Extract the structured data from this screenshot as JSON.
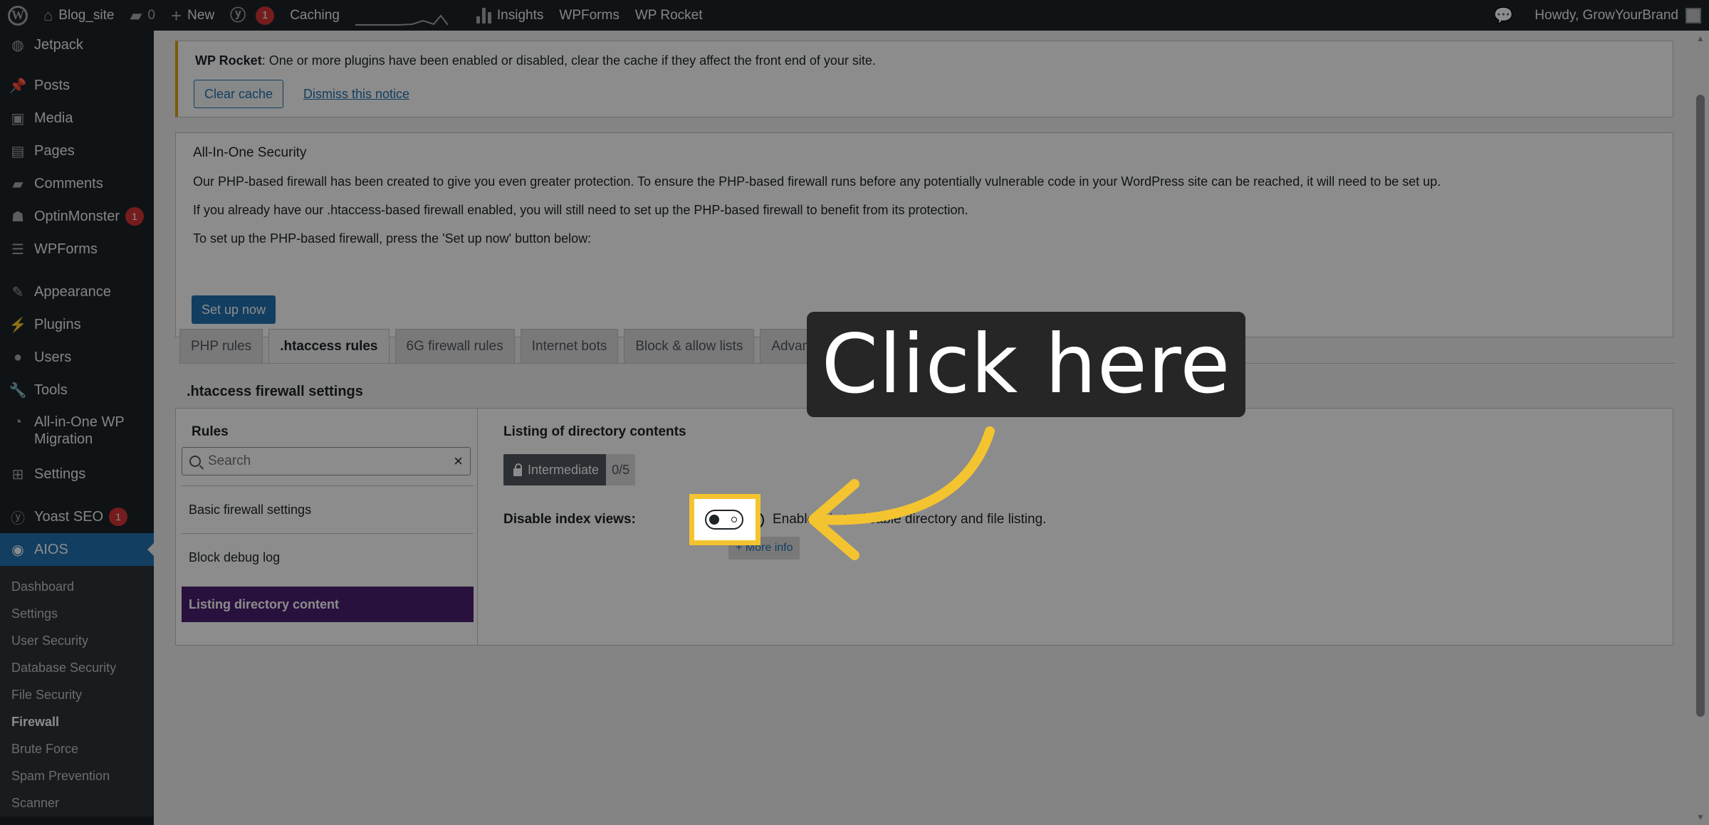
{
  "adminbar": {
    "site_name": "Blog_site",
    "comments_count": "0",
    "new_label": "New",
    "yoast_badge": "1",
    "caching_label": "Caching",
    "insights_label": "Insights",
    "wpforms_label": "WPForms",
    "wprocket_label": "WP Rocket",
    "howdy": "Howdy, GrowYourBrand"
  },
  "sidebar": {
    "items": [
      {
        "label": "Jetpack",
        "icon": "jetpack-icon"
      },
      {
        "label": "Posts",
        "icon": "pin-icon"
      },
      {
        "label": "Media",
        "icon": "media-icon"
      },
      {
        "label": "Pages",
        "icon": "pages-icon"
      },
      {
        "label": "Comments",
        "icon": "comment-icon"
      },
      {
        "label": "OptinMonster",
        "icon": "optinmonster-icon",
        "badge": "1"
      },
      {
        "label": "WPForms",
        "icon": "wpforms-icon"
      },
      {
        "label": "Appearance",
        "icon": "brush-icon"
      },
      {
        "label": "Plugins",
        "icon": "plugin-icon"
      },
      {
        "label": "Users",
        "icon": "user-icon"
      },
      {
        "label": "Tools",
        "icon": "wrench-icon"
      },
      {
        "label": "All-in-One WP Migration",
        "icon": "migration-icon"
      },
      {
        "label": "Settings",
        "icon": "settings-icon"
      },
      {
        "label": "Yoast SEO",
        "icon": "yoast-icon",
        "badge": "1"
      },
      {
        "label": "AIOS",
        "icon": "aios-icon"
      }
    ],
    "submenu": [
      "Dashboard",
      "Settings",
      "User Security",
      "Database Security",
      "File Security",
      "Firewall",
      "Brute Force",
      "Spam Prevention",
      "Scanner"
    ],
    "submenu_current": "Firewall"
  },
  "notice_rocket": {
    "brand": "WP Rocket",
    "text": ": One or more plugins have been enabled or disabled, clear the cache if they affect the front end of your site.",
    "clear_cache": "Clear cache",
    "dismiss": "Dismiss this notice"
  },
  "notice_aios": {
    "heading": "All-In-One Security",
    "p1": "Our PHP-based firewall has been created to give you even greater protection. To ensure the PHP-based firewall runs before any potentially vulnerable code in your WordPress site can be reached, it will need to be set up.",
    "p2": "If you already have our .htaccess-based firewall enabled, you will still need to set up the PHP-based firewall to benefit from its protection.",
    "p3": "To set up the PHP-based firewall, press the 'Set up now' button below:",
    "setup": "Set up now"
  },
  "tabs": [
    "PHP rules",
    ".htaccess rules",
    "6G firewall rules",
    "Internet bots",
    "Block & allow lists",
    "Advanced settings"
  ],
  "active_tab": ".htaccess rules",
  "section_title": ".htaccess firewall settings",
  "rules_panel": {
    "heading": "Rules",
    "search_placeholder": "Search",
    "items": [
      "Basic firewall settings",
      "Block debug log",
      "Listing directory content"
    ],
    "selected": "Listing directory content"
  },
  "detail": {
    "heading": "Listing of directory contents",
    "level": "Intermediate",
    "points": "0/5",
    "option_label": "Disable index views:",
    "option_desc": "Enable this to disable directory and file listing.",
    "more_info": "+ More info",
    "toggle_on": false
  },
  "overlay": {
    "callout": "Click here",
    "accent": "#f4c430"
  },
  "colors": {
    "admin_dark": "#1d2327",
    "wp_blue": "#2271b1",
    "aios_purple": "#4b1f72",
    "badge_red": "#d63638"
  }
}
